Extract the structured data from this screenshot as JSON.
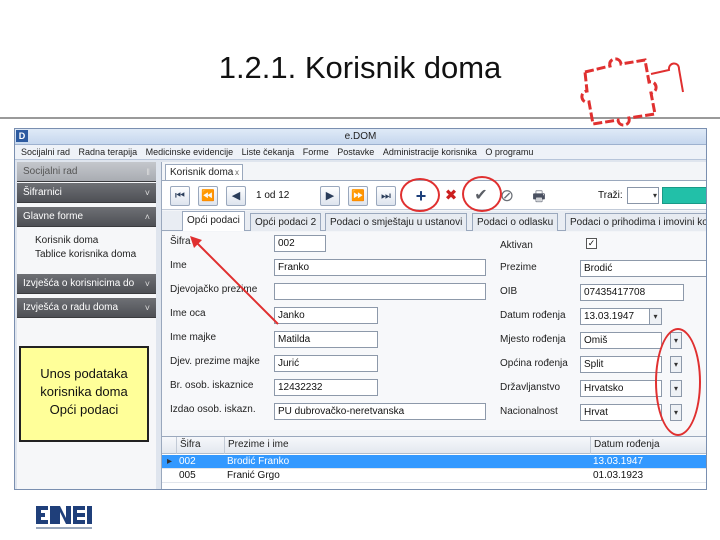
{
  "slide": {
    "title": "1.2.1. Korisnik doma"
  },
  "app": {
    "title": "e.DOM",
    "logo_letter": "D",
    "menu": [
      "Socijalni rad",
      "Radna terapija",
      "Medicinske evidencije",
      "Liste čekanja",
      "Forme",
      "Postavke",
      "Administracije korisnika",
      "O programu"
    ]
  },
  "sidebar": {
    "top_header": "Socijalni rad",
    "sections": [
      {
        "label": "Šifrarnici",
        "chevron": "˅"
      },
      {
        "label": "Glavne forme",
        "chevron": "˄"
      },
      {
        "label": "Izvješća o korisnicima do",
        "chevron": "˅"
      },
      {
        "label": "Izvješća o radu doma",
        "chevron": "˅"
      }
    ],
    "sub_items": [
      "Korisnik doma",
      "Tablice korisnika doma"
    ]
  },
  "annotation": {
    "line1": "Unos podataka",
    "line2": "korisnika doma",
    "line3": "Opći podaci"
  },
  "main": {
    "doc_tab": "Korisnik doma",
    "doc_tab_close": "x",
    "pager": "1 od 12",
    "search_label": "Traži:",
    "tabs": [
      "Opći podaci",
      "Opći podaci 2",
      "Podaci o smještaju u ustanovi",
      "Podaci o odlasku",
      "Podaci o prihodima i imovini korisnika"
    ]
  },
  "toolbar_icons": {
    "first": "⏮",
    "prev_page": "⏪",
    "prev": "◀",
    "next": "▶",
    "next_page": "⏩",
    "last": "⏭",
    "add": "+",
    "delete": "✖",
    "confirm": "✔",
    "cancel": "⊘",
    "print": "🖶"
  },
  "form": {
    "left": [
      {
        "label": "Šifra",
        "value": "002"
      },
      {
        "label": "Ime",
        "value": "Franko"
      },
      {
        "label": "Djevojačko prezime",
        "value": ""
      },
      {
        "label": "Ime oca",
        "value": "Janko"
      },
      {
        "label": "Ime majke",
        "value": "Matilda"
      },
      {
        "label": "Djev. prezime majke",
        "value": "Jurić"
      },
      {
        "label": "Br. osob. iskaznice",
        "value": "12432232"
      },
      {
        "label": "Izdao osob. iskazn.",
        "value": "PU dubrovačko-neretvanska"
      }
    ],
    "right": [
      {
        "label": "Aktivan",
        "value": "✓"
      },
      {
        "label": "Prezime",
        "value": "Brodić"
      },
      {
        "label": "OIB",
        "value": "07435417708"
      },
      {
        "label": "Datum rođenja",
        "value": "13.03.1947"
      },
      {
        "label": "Mjesto rođenja",
        "value": "Omiš"
      },
      {
        "label": "Općina rođenja",
        "value": "Split"
      },
      {
        "label": "Državljanstvo",
        "value": "Hrvatsko"
      },
      {
        "label": "Nacionalnost",
        "value": "Hrvat"
      }
    ],
    "dropdown_arrow": "▾"
  },
  "grid": {
    "columns": [
      "Šifra",
      "Prezime i ime",
      "Datum rođenja"
    ],
    "rows": [
      {
        "marker": "▸",
        "sifra": "002",
        "name": "Brodić Franko",
        "date": "13.03.1947"
      },
      {
        "marker": "",
        "sifra": "005",
        "name": "Franić Grgo",
        "date": "01.03.1923"
      }
    ]
  },
  "colors": {
    "annotation_red": "#e03030",
    "note_yellow": "#ffff99",
    "selected_row": "#3399ff",
    "search_teal": "#22c0a8"
  }
}
